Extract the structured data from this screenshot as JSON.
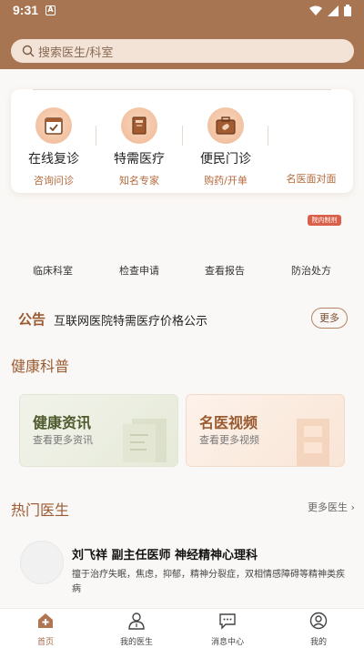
{
  "status_bar": {
    "time": "9:31",
    "notif": "A"
  },
  "search": {
    "placeholder": "搜索医生/科室"
  },
  "services": [
    {
      "title": "在线复诊",
      "subtitle": "咨询问诊",
      "icon": "clipboard-check-icon"
    },
    {
      "title": "特需医疗",
      "subtitle": "知名专家",
      "icon": "book-icon"
    },
    {
      "title": "便民门诊",
      "subtitle": "购药/开单",
      "icon": "medicine-kit-icon"
    },
    {
      "title": "",
      "subtitle": "名医面对面",
      "icon": ""
    }
  ],
  "inhouse_badge": "院内制剂",
  "quick_links": [
    "临床科室",
    "检查申请",
    "查看报告",
    "防治处方"
  ],
  "notice": {
    "label": "公告",
    "text": "互联网医院特需医疗价格公示",
    "more": "更多"
  },
  "health": {
    "title": "健康科普",
    "cards": [
      {
        "title": "健康资讯",
        "subtitle": "查看更多资讯"
      },
      {
        "title": "名医视频",
        "subtitle": "查看更多视频"
      }
    ]
  },
  "hot_doctors": {
    "title": "热门医生",
    "more": "更多医生 ›",
    "doctor": {
      "name": "刘飞祥  副主任医师  神经精神心理科",
      "desc": "擅于治疗失眠，焦虑，抑郁，精神分裂症，双相情感障碍等精神类疾病"
    }
  },
  "tabbar": [
    {
      "label": "首页",
      "active": true
    },
    {
      "label": "我的医生",
      "active": false
    },
    {
      "label": "消息中心",
      "active": false
    },
    {
      "label": "我的",
      "active": false
    }
  ],
  "colors": {
    "brand": "#a87552",
    "accent": "#9a5a30",
    "badge": "#d9604b"
  }
}
